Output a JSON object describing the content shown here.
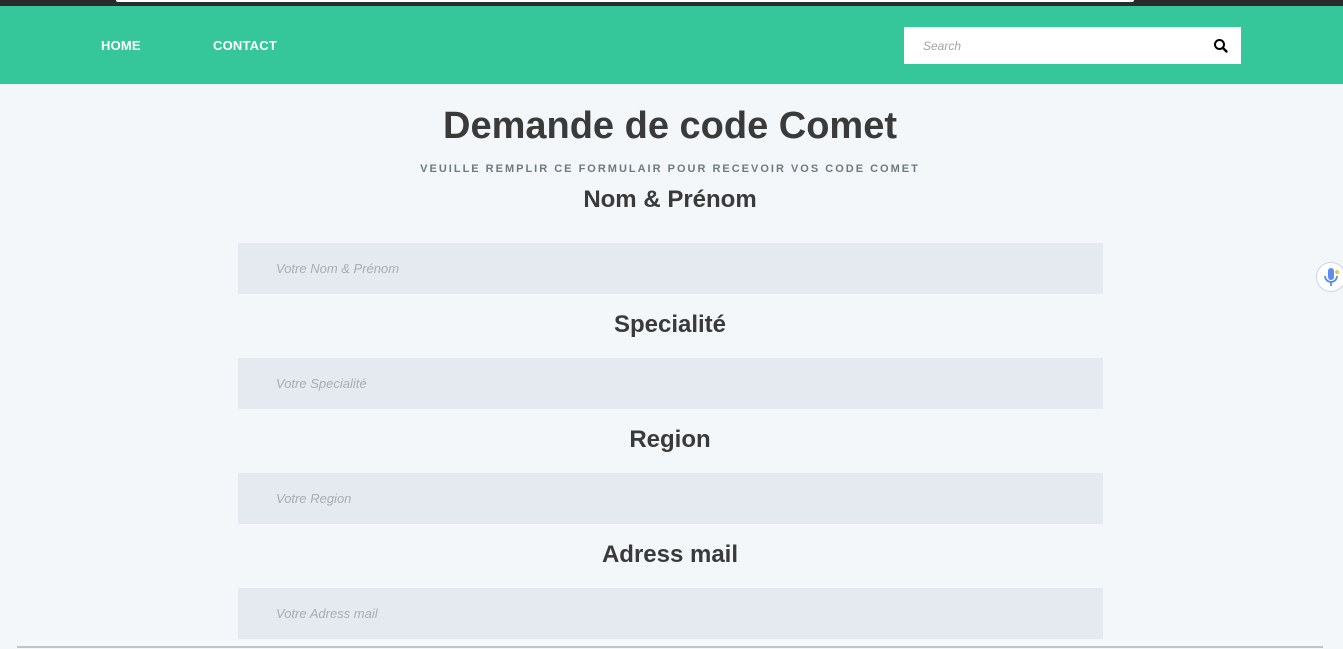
{
  "nav": {
    "home_label": "HOME",
    "contact_label": "CONTACT",
    "search_placeholder": "Search"
  },
  "header": {
    "title": "Demande de code Comet",
    "subtitle": "VEUILLE REMPLIR CE FORMULAIR POUR RECEVOIR VOS CODE COMET"
  },
  "form": {
    "fields": [
      {
        "label": "Nom & Prénom",
        "placeholder": "Votre Nom & Prénom",
        "value": ""
      },
      {
        "label": "Specialité",
        "placeholder": "Votre Specialité",
        "value": ""
      },
      {
        "label": "Region",
        "placeholder": "Votre Region",
        "value": ""
      },
      {
        "label": "Adress mail",
        "placeholder": "Votre Adress mail",
        "value": ""
      }
    ]
  },
  "icons": {
    "search": "search-icon",
    "mic": "microphone-icon"
  },
  "colors": {
    "nav_bg": "#35c79a",
    "page_bg": "#f3f7fa",
    "input_bg": "#e4eaf0",
    "text_dark": "#3a3a3a",
    "mic_blue": "#5b8def",
    "mic_yellow": "#f4c542"
  }
}
